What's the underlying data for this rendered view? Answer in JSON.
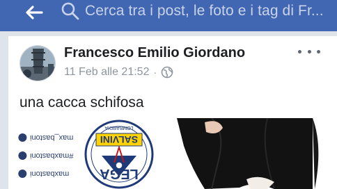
{
  "header": {
    "back_icon": "arrow-left-icon",
    "search_icon": "search-icon",
    "search_placeholder": "Cerca tra i post, le foto e i tag di Fr...",
    "bar_color": "#4267b2"
  },
  "post": {
    "author": "Francesco Emilio Giordano",
    "date": "11 Feb alle 21:52",
    "separator": "·",
    "privacy_icon": "globe-icon",
    "more_icon": "more-horizontal-icon",
    "text": "una cacca schifosa",
    "image": {
      "social_handles": [
        "max_bastoni",
        "#maxbastoni",
        "maxbastoni"
      ],
      "logo_top_text": "LOMBARDIA",
      "logo_name": "SALVINI",
      "logo_bottom_text": "LEGA"
    }
  }
}
